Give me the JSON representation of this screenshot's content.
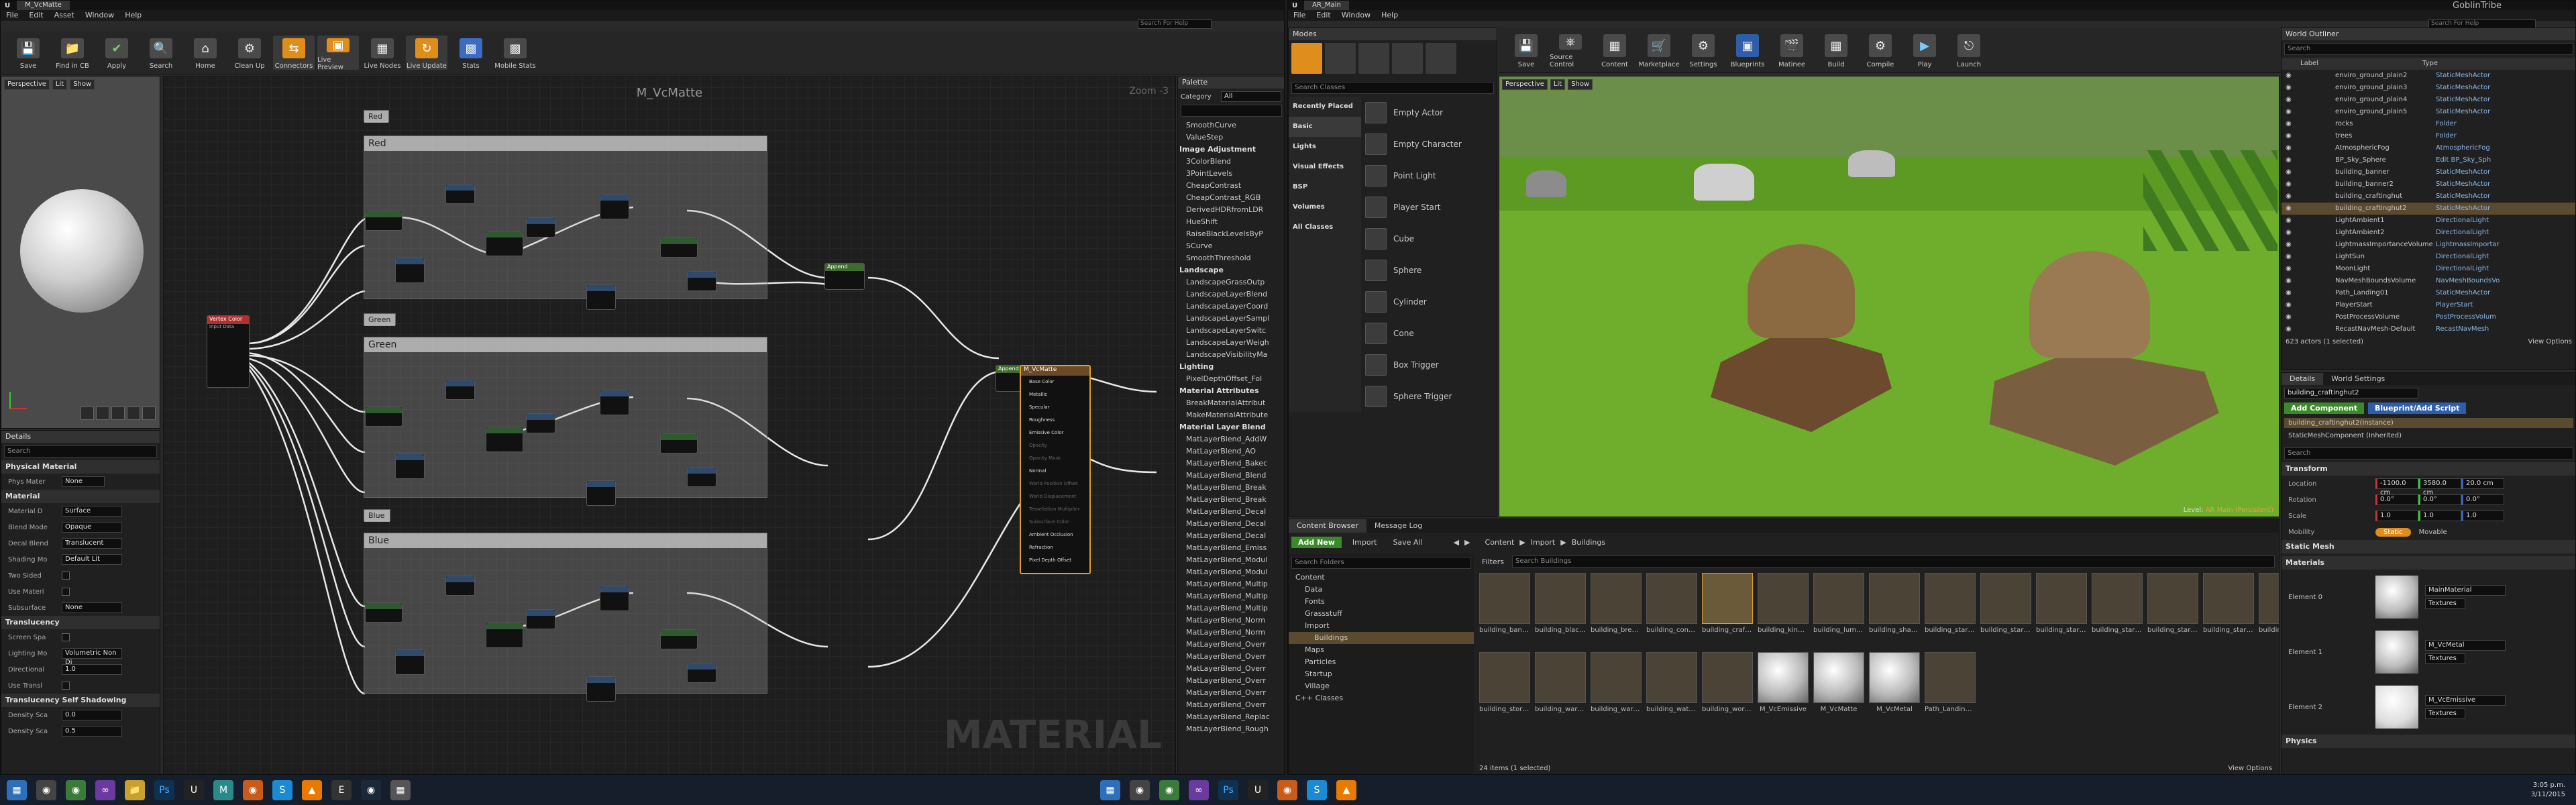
{
  "material_editor": {
    "tab_title": "M_VcMatte",
    "menu": [
      "File",
      "Edit",
      "Asset",
      "Window",
      "Help"
    ],
    "search_placeholder": "Search For Help",
    "toolbar": [
      "Save",
      "Find in CB",
      "Apply",
      "Search",
      "Home",
      "Clean Up",
      "Connectors",
      "Live Preview",
      "Live Nodes",
      "Live Update",
      "Stats",
      "Mobile Stats"
    ],
    "viewport_buttons": [
      "Perspective",
      "Lit",
      "Show"
    ],
    "graph_title": "M_VcMatte",
    "zoom": "Zoom -3",
    "watermark": "MATERIAL",
    "comments": [
      "Red",
      "Red",
      "Green",
      "Green",
      "Blue",
      "Blue"
    ],
    "vertex_node": "Vertex Color",
    "vertex_sub": "Input Data",
    "append_nodes": [
      "Append",
      "Append"
    ],
    "result_node": "M_VcMatte",
    "result_pins": [
      "Base Color",
      "Metallic",
      "Specular",
      "Roughness",
      "Emissive Color",
      "Opacity",
      "Opacity Mask",
      "Normal",
      "World Position Offset",
      "World Displacement",
      "Tessellation Multiplier",
      "Subsurface Color",
      "Ambient Occlusion",
      "Refraction",
      "Pixel Depth Offset"
    ],
    "details": {
      "tab": "Details",
      "search_placeholder": "Search",
      "physical_section": "Physical Material",
      "phys_mat_label": "Phys Mater",
      "phys_mat_value": "None",
      "material_section": "Material",
      "rows": [
        {
          "label": "Material D",
          "value": "Surface"
        },
        {
          "label": "Blend Mode",
          "value": "Opaque"
        },
        {
          "label": "Decal Blend",
          "value": "Translucent"
        },
        {
          "label": "Shading Mo",
          "value": "Default Lit"
        },
        {
          "label": "Two Sided",
          "value": ""
        },
        {
          "label": "Use Materi",
          "value": ""
        },
        {
          "label": "Subsurface",
          "value": "None"
        }
      ],
      "translucency_section": "Translucency",
      "trans_rows": [
        {
          "label": "Screen Spa",
          "value": ""
        },
        {
          "label": "Lighting Mo",
          "value": "Volumetric Non Di"
        },
        {
          "label": "Directional",
          "value": "1.0"
        },
        {
          "label": "Use Transl",
          "value": ""
        }
      ],
      "shadow_section": "Translucency Self Shadowing",
      "shadow_rows": [
        {
          "label": "Density Sca",
          "value": "0.0"
        },
        {
          "label": "Density Sca",
          "value": "0.5"
        }
      ]
    },
    "palette": {
      "tab": "Palette",
      "category_label": "Category",
      "category_value": "All",
      "items": [
        {
          "text": "SmoothCurve",
          "cat": false
        },
        {
          "text": "ValueStep",
          "cat": false
        },
        {
          "text": "Image Adjustment",
          "cat": true
        },
        {
          "text": "3ColorBlend",
          "cat": false
        },
        {
          "text": "3PointLevels",
          "cat": false
        },
        {
          "text": "CheapContrast",
          "cat": false
        },
        {
          "text": "CheapContrast_RGB",
          "cat": false
        },
        {
          "text": "DerivedHDRfromLDR",
          "cat": false
        },
        {
          "text": "HueShift",
          "cat": false
        },
        {
          "text": "RaiseBlackLevelsByP",
          "cat": false
        },
        {
          "text": "SCurve",
          "cat": false
        },
        {
          "text": "SmoothThreshold",
          "cat": false
        },
        {
          "text": "Landscape",
          "cat": true
        },
        {
          "text": "LandscapeGrassOutp",
          "cat": false
        },
        {
          "text": "LandscapeLayerBlend",
          "cat": false
        },
        {
          "text": "LandscapeLayerCoord",
          "cat": false
        },
        {
          "text": "LandscapeLayerSampl",
          "cat": false
        },
        {
          "text": "LandscapeLayerSwitc",
          "cat": false
        },
        {
          "text": "LandscapeLayerWeigh",
          "cat": false
        },
        {
          "text": "LandscapeVisibilityMa",
          "cat": false
        },
        {
          "text": "Lighting",
          "cat": true
        },
        {
          "text": "PixelDepthOffset_Fol",
          "cat": false
        },
        {
          "text": "Material Attributes",
          "cat": true
        },
        {
          "text": "BreakMaterialAttribut",
          "cat": false
        },
        {
          "text": "MakeMaterialAttribute",
          "cat": false
        },
        {
          "text": "Material Layer Blend",
          "cat": true
        },
        {
          "text": "MatLayerBlend_AddW",
          "cat": false
        },
        {
          "text": "MatLayerBlend_AO",
          "cat": false
        },
        {
          "text": "MatLayerBlend_Bakec",
          "cat": false
        },
        {
          "text": "MatLayerBlend_Blend",
          "cat": false
        },
        {
          "text": "MatLayerBlend_Break",
          "cat": false
        },
        {
          "text": "MatLayerBlend_Break",
          "cat": false
        },
        {
          "text": "MatLayerBlend_Decal",
          "cat": false
        },
        {
          "text": "MatLayerBlend_Decal",
          "cat": false
        },
        {
          "text": "MatLayerBlend_Decal",
          "cat": false
        },
        {
          "text": "MatLayerBlend_Emiss",
          "cat": false
        },
        {
          "text": "MatLayerBlend_Modul",
          "cat": false
        },
        {
          "text": "MatLayerBlend_Modul",
          "cat": false
        },
        {
          "text": "MatLayerBlend_Multip",
          "cat": false
        },
        {
          "text": "MatLayerBlend_Multip",
          "cat": false
        },
        {
          "text": "MatLayerBlend_Multip",
          "cat": false
        },
        {
          "text": "MatLayerBlend_Norm",
          "cat": false
        },
        {
          "text": "MatLayerBlend_Norm",
          "cat": false
        },
        {
          "text": "MatLayerBlend_Overr",
          "cat": false
        },
        {
          "text": "MatLayerBlend_Overr",
          "cat": false
        },
        {
          "text": "MatLayerBlend_Overr",
          "cat": false
        },
        {
          "text": "MatLayerBlend_Overr",
          "cat": false
        },
        {
          "text": "MatLayerBlend_Overr",
          "cat": false
        },
        {
          "text": "MatLayerBlend_Overr",
          "cat": false
        },
        {
          "text": "MatLayerBlend_Replac",
          "cat": false
        },
        {
          "text": "MatLayerBlend_Rough",
          "cat": false
        }
      ]
    }
  },
  "level_editor": {
    "tab_title": "AR_Main",
    "project": "GoblinTribe",
    "menu": [
      "File",
      "Edit",
      "Window",
      "Help"
    ],
    "search_placeholder": "Search For Help",
    "modes_tab": "Modes",
    "search_classes": "Search Classes",
    "place_categories": [
      "Recently Placed",
      "Basic",
      "Lights",
      "Visual Effects",
      "BSP",
      "Volumes",
      "All Classes"
    ],
    "place_items": [
      "Empty Actor",
      "Empty Character",
      "Point Light",
      "Player Start",
      "Cube",
      "Sphere",
      "Cylinder",
      "Cone",
      "Box Trigger",
      "Sphere Trigger"
    ],
    "toolbar": [
      "Save",
      "Source Control",
      "Content",
      "Marketplace",
      "Settings",
      "Blueprints",
      "Matinee",
      "Build",
      "Compile",
      "Play",
      "Launch"
    ],
    "viewport_buttons": [
      "Perspective",
      "Lit",
      "Show"
    ],
    "level_label": "Level:",
    "level_name": "AR Main (Persistent)",
    "content_browser": {
      "tabs": [
        "Content Browser",
        "Message Log"
      ],
      "buttons": [
        "Add New",
        "Import",
        "Save All"
      ],
      "path": [
        "Content",
        "Import",
        "Buildings"
      ],
      "search_folders": "Search Folders",
      "filters": "Filters",
      "search_assets": "Search Buildings",
      "tree": [
        {
          "text": "Content",
          "depth": 0
        },
        {
          "text": "Data",
          "depth": 1
        },
        {
          "text": "Fonts",
          "depth": 1
        },
        {
          "text": "Grassstuff",
          "depth": 1
        },
        {
          "text": "Import",
          "depth": 1
        },
        {
          "text": "Buildings",
          "depth": 2
        },
        {
          "text": "Maps",
          "depth": 1
        },
        {
          "text": "Particles",
          "depth": 1
        },
        {
          "text": "Startup",
          "depth": 1
        },
        {
          "text": "Village",
          "depth": 1
        },
        {
          "text": "C++ Classes",
          "depth": 0
        }
      ],
      "assets_row1": [
        "building_banner",
        "building_blacksmith",
        "building_brewery",
        "building_constructionsite",
        "building_craftinghut",
        "building_kingsqueen",
        "building_lumbermill",
        "building_shamanhut",
        "building_startingWagon_00",
        "building_startingWagon_01",
        "building_startingWagon_02",
        "building_startingWagon_03",
        "building_startingWagon_04",
        "building_startingWagon_05",
        "building_startingWagon_06"
      ],
      "assets_row2": [
        "building_storage",
        "building_warcamp",
        "building_warcamp_gate",
        "building_watchtower",
        "building_workcamp",
        "M_VcEmissive",
        "M_VcMatte",
        "M_VcMetal",
        "Path_Landing01"
      ],
      "status": "24 items (1 selected)",
      "view_options": "View Options"
    },
    "outliner": {
      "tab": "World Outliner",
      "search_placeholder": "Search",
      "col_label": "Label",
      "col_type": "Type",
      "rows": [
        {
          "label": "enviro_ground_plain2",
          "type": "StaticMeshActor",
          "sel": false
        },
        {
          "label": "enviro_ground_plain3",
          "type": "StaticMeshActor",
          "sel": false
        },
        {
          "label": "enviro_ground_plain4",
          "type": "StaticMeshActor",
          "sel": false
        },
        {
          "label": "enviro_ground_plain5",
          "type": "StaticMeshActor",
          "sel": false
        },
        {
          "label": "rocks",
          "type": "Folder",
          "sel": false
        },
        {
          "label": "trees",
          "type": "Folder",
          "sel": false
        },
        {
          "label": "AtmosphericFog",
          "type": "AtmosphericFog",
          "sel": false
        },
        {
          "label": "BP_Sky_Sphere",
          "type": "Edit BP_Sky_Sph",
          "sel": false
        },
        {
          "label": "building_banner",
          "type": "StaticMeshActor",
          "sel": false
        },
        {
          "label": "building_banner2",
          "type": "StaticMeshActor",
          "sel": false
        },
        {
          "label": "building_craftinghut",
          "type": "StaticMeshActor",
          "sel": false
        },
        {
          "label": "building_craftinghut2",
          "type": "StaticMeshActor",
          "sel": true
        },
        {
          "label": "LightAmbient1",
          "type": "DirectionalLight",
          "sel": false
        },
        {
          "label": "LightAmbient2",
          "type": "DirectionalLight",
          "sel": false
        },
        {
          "label": "LightmassImportanceVolume",
          "type": "LightmassImportar",
          "sel": false
        },
        {
          "label": "LightSun",
          "type": "DirectionalLight",
          "sel": false
        },
        {
          "label": "MoonLight",
          "type": "DirectionalLight",
          "sel": false
        },
        {
          "label": "NavMeshBoundsVolume",
          "type": "NavMeshBoundsVo",
          "sel": false
        },
        {
          "label": "Path_Landing01",
          "type": "StaticMeshActor",
          "sel": false
        },
        {
          "label": "PlayerStart",
          "type": "PlayerStart",
          "sel": false
        },
        {
          "label": "PostProcessVolume",
          "type": "PostProcessVolum",
          "sel": false
        },
        {
          "label": "RecastNavMesh-Default",
          "type": "RecastNavMesh",
          "sel": false
        }
      ],
      "status": "623 actors (1 selected)",
      "view_options": "View Options"
    },
    "details": {
      "tabs": [
        "Details",
        "World Settings"
      ],
      "name": "building_craftinghut2",
      "add_component": "Add Component",
      "blueprint_script": "Blueprint/Add Script",
      "instance": "building_craftinghut2(Instance)",
      "component": "StaticMeshComponent (Inherited)",
      "search_placeholder": "Search",
      "transform": "Transform",
      "location_label": "Location",
      "location": [
        "-1100.0 cm",
        "3580.0 cm",
        "20.0 cm"
      ],
      "rotation_label": "Rotation",
      "rotation": [
        "0.0°",
        "0.0°",
        "0.0°"
      ],
      "scale_label": "Scale",
      "scale": [
        "1.0",
        "1.0",
        "1.0"
      ],
      "mobility_label": "Mobility",
      "mobility": [
        "Static",
        "Movable"
      ],
      "static_mesh": "Static Mesh",
      "materials": "Materials",
      "elements": [
        {
          "label": "Element 0",
          "name": "MainMaterial",
          "sub": "Textures"
        },
        {
          "label": "Element 1",
          "name": "M_VcMetal",
          "sub": "Textures"
        },
        {
          "label": "Element 2",
          "name": "M_VcEmissive",
          "sub": "Textures"
        }
      ],
      "physics": "Physics"
    }
  },
  "taskbar": {
    "time": "3:05 p.m.",
    "date": "3/11/2015"
  },
  "colors": {
    "accent_orange": "#e08e1b",
    "grass_green": "#6fae2c",
    "selection": "#5a4a30"
  }
}
